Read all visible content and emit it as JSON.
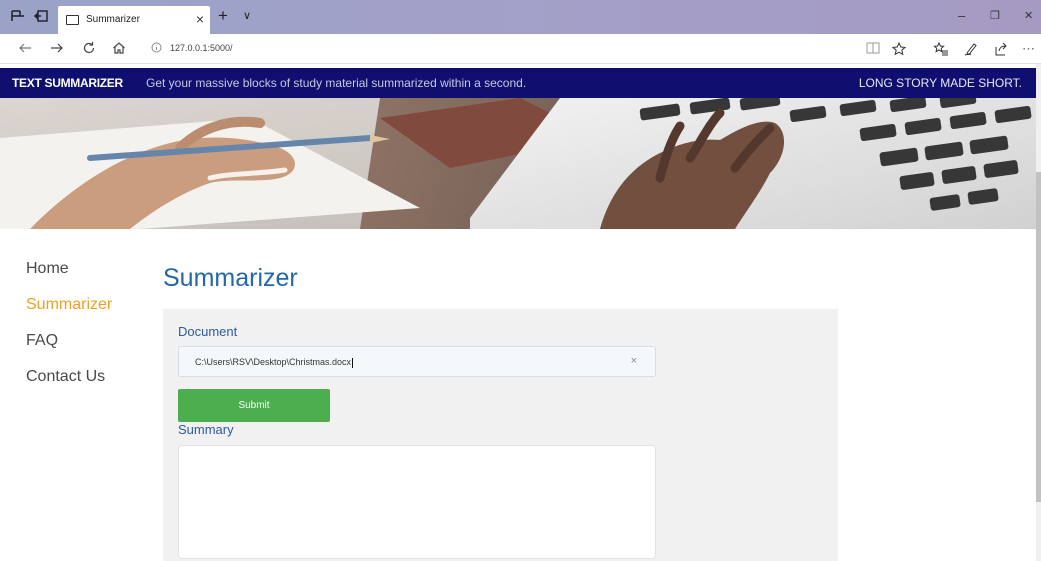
{
  "browser": {
    "tab_title": "Summarizer",
    "tab_close": "×",
    "new_tab": "+",
    "tab_list": "∨",
    "url": "127.0.0.1:5000/",
    "window_controls": {
      "minimize": "–",
      "restore": "❐",
      "close": "✕"
    },
    "icons": {
      "tab_actions": "tab-set-aside-icon",
      "tab_preview": "tab-preview-icon",
      "back": "back-arrow-icon",
      "forward": "forward-arrow-icon",
      "refresh": "refresh-icon",
      "home": "home-icon",
      "site_info": "info-icon",
      "reading_view": "reading-view-icon",
      "favorite": "star-icon",
      "favorites_hub": "favorites-hub-icon",
      "notes": "pen-icon",
      "share": "share-icon",
      "more": "more-icon"
    }
  },
  "header": {
    "brand": "TEXT SUMMARIZER",
    "tagline": "Get your massive blocks of study material summarized within a second.",
    "motto": "LONG STORY MADE SHORT.",
    "background_color": "#0e0f6e"
  },
  "sidebar": {
    "items": [
      {
        "label": "Home",
        "active": false
      },
      {
        "label": "Summarizer",
        "active": true
      },
      {
        "label": "FAQ",
        "active": false
      },
      {
        "label": "Contact Us",
        "active": false
      }
    ],
    "active_color": "#f0a020"
  },
  "main": {
    "title": "Summarizer",
    "document_label": "Document",
    "document_value": "C:\\Users\\RSV\\Desktop\\Christmas.docx",
    "clear_symbol": "×",
    "submit_label": "Submit",
    "summary_label": "Summary",
    "summary_value": "",
    "accent_color": "#2368a8",
    "button_color": "#4cae4f"
  }
}
